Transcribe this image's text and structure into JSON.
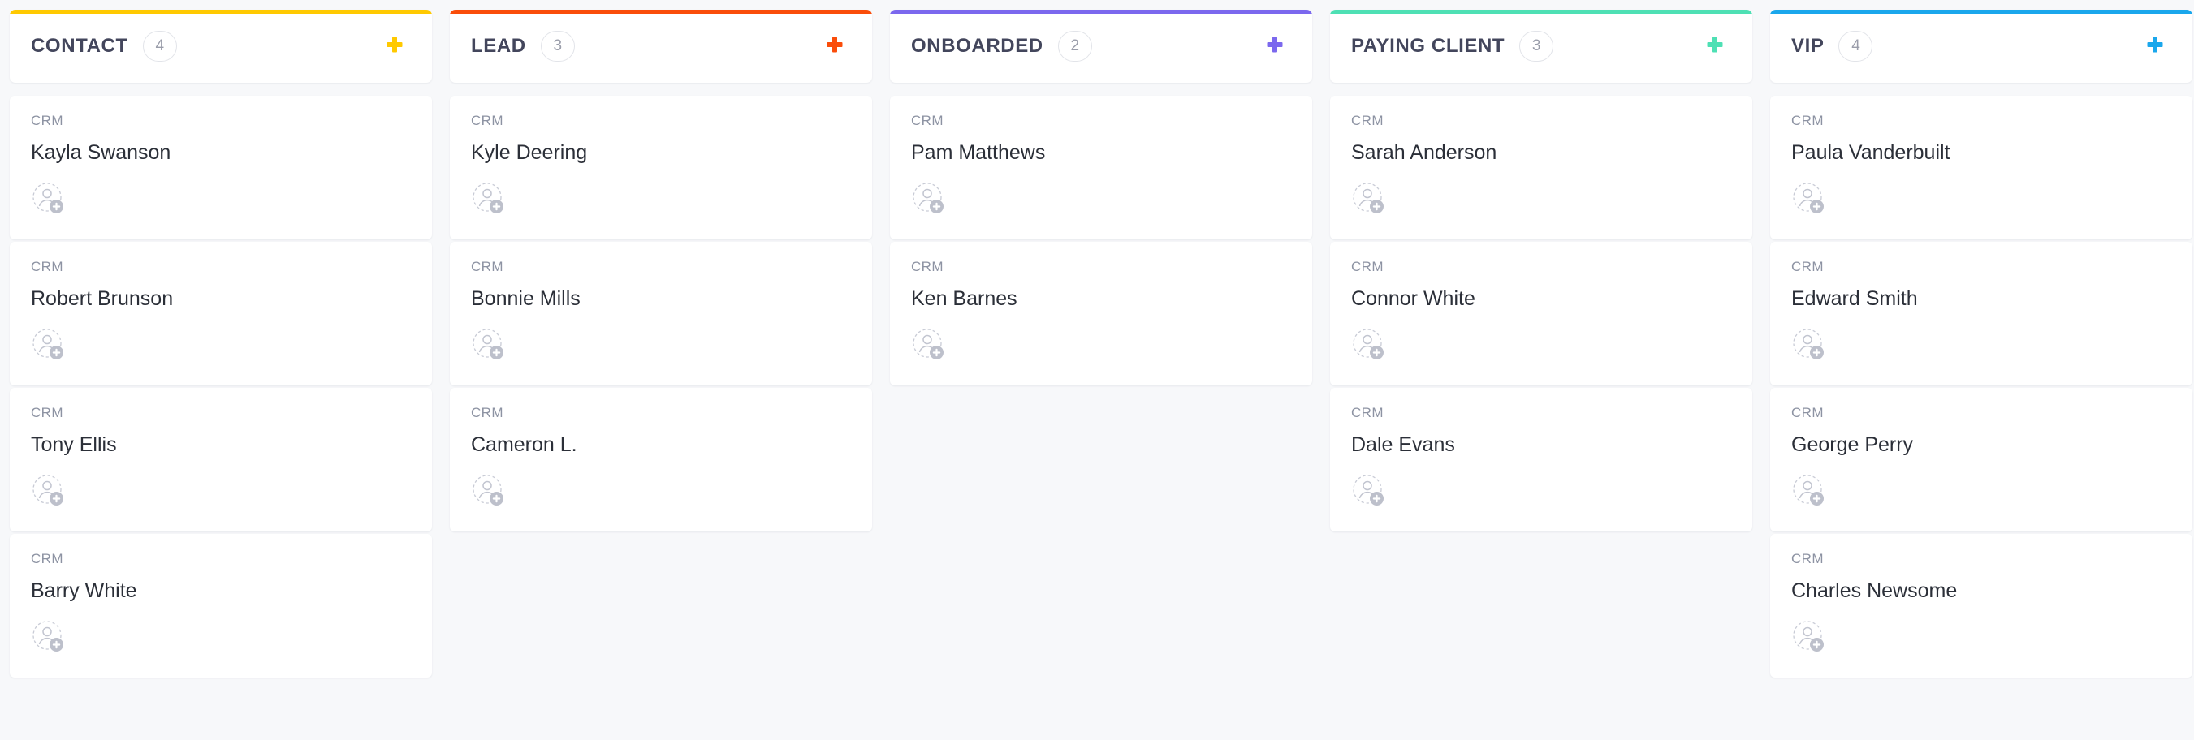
{
  "board": {
    "columns": [
      {
        "title": "CONTACT",
        "count": "4",
        "accent": "#ffc900",
        "add_label": "+",
        "cards": [
          {
            "tag": "CRM",
            "name": "Kayla Swanson"
          },
          {
            "tag": "CRM",
            "name": "Robert Brunson"
          },
          {
            "tag": "CRM",
            "name": "Tony Ellis"
          },
          {
            "tag": "CRM",
            "name": "Barry White"
          }
        ]
      },
      {
        "title": "LEAD",
        "count": "3",
        "accent": "#fa4d0a",
        "add_label": "+",
        "cards": [
          {
            "tag": "CRM",
            "name": "Kyle Deering"
          },
          {
            "tag": "CRM",
            "name": "Bonnie Mills"
          },
          {
            "tag": "CRM",
            "name": "Cameron L."
          }
        ]
      },
      {
        "title": "ONBOARDED",
        "count": "2",
        "accent": "#7b68ee",
        "add_label": "+",
        "cards": [
          {
            "tag": "CRM",
            "name": "Pam Matthews"
          },
          {
            "tag": "CRM",
            "name": "Ken Barnes"
          }
        ]
      },
      {
        "title": "PAYING CLIENT",
        "count": "3",
        "accent": "#4ee0b4",
        "add_label": "+",
        "cards": [
          {
            "tag": "CRM",
            "name": "Sarah Anderson"
          },
          {
            "tag": "CRM",
            "name": "Connor White"
          },
          {
            "tag": "CRM",
            "name": "Dale Evans"
          }
        ]
      },
      {
        "title": "VIP",
        "count": "4",
        "accent": "#1aa7ec",
        "add_label": "+",
        "cards": [
          {
            "tag": "CRM",
            "name": "Paula Vanderbuilt"
          },
          {
            "tag": "CRM",
            "name": "Edward Smith"
          },
          {
            "tag": "CRM",
            "name": "George Perry"
          },
          {
            "tag": "CRM",
            "name": "Charles Newsome"
          }
        ]
      }
    ]
  },
  "icons": {
    "add": "plus-icon",
    "assignee": "add-assignee-icon"
  }
}
